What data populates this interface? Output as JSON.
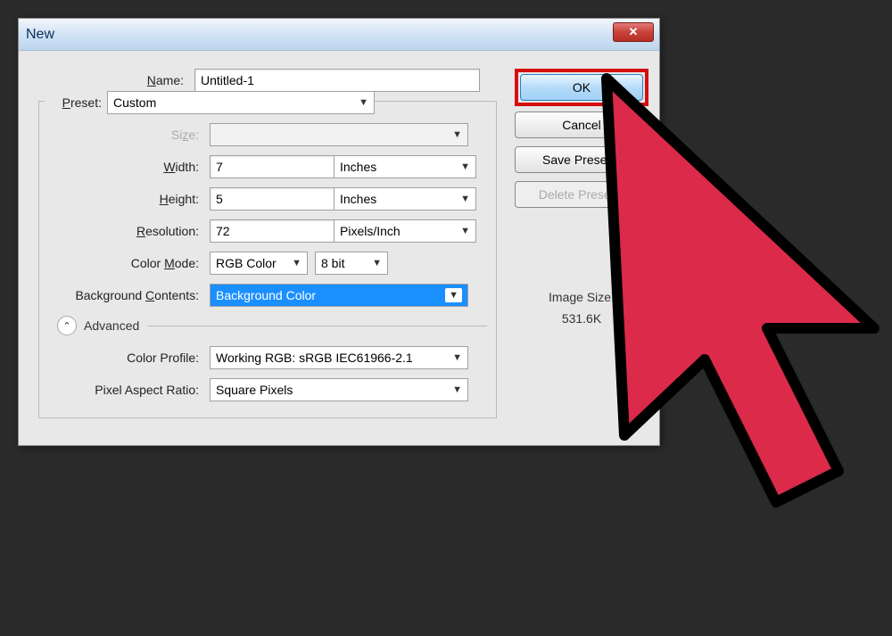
{
  "dialog": {
    "title": "New"
  },
  "fields": {
    "name_label": "Name:",
    "name_value": "Untitled-1",
    "preset_label": "Preset:",
    "preset_value": "Custom",
    "size_label": "Size:",
    "size_value": "",
    "width_label": "Width:",
    "width_value": "7",
    "width_unit": "Inches",
    "height_label": "Height:",
    "height_value": "5",
    "height_unit": "Inches",
    "resolution_label": "Resolution:",
    "resolution_value": "72",
    "resolution_unit": "Pixels/Inch",
    "colormode_label": "Color Mode:",
    "colormode_value": "RGB Color",
    "colormode_depth": "8 bit",
    "bg_label": "Background Contents:",
    "bg_value": "Background Color",
    "advanced_label": "Advanced",
    "profile_label": "Color Profile:",
    "profile_value": "Working RGB:  sRGB IEC61966-2.1",
    "pixelaspect_label": "Pixel Aspect Ratio:",
    "pixelaspect_value": "Square Pixels"
  },
  "buttons": {
    "ok": "OK",
    "cancel": "Cancel",
    "save_preset": "Save Preset...",
    "delete_preset": "Delete Preset..."
  },
  "info": {
    "image_size_label": "Image Size:",
    "image_size_value": "531.6K"
  }
}
